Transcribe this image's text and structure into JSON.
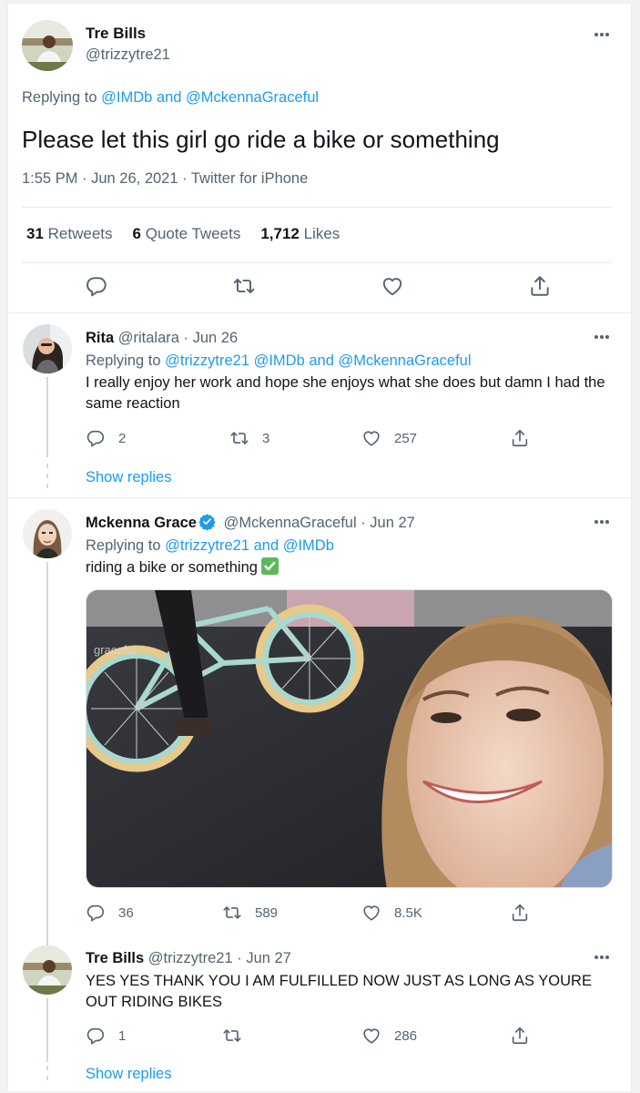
{
  "main_tweet": {
    "name": "Tre Bills",
    "handle": "@trizzytre21",
    "replying_prefix": "Replying to",
    "replying_to": "@IMDb and @MckennaGraceful",
    "text": "Please let this girl go ride a bike or something",
    "timestamp": "1:55 PM · Jun 26, 2021 · Twitter for iPhone",
    "stats": {
      "retweets_count": "31",
      "retweets_label": "Retweets",
      "quotes_count": "6",
      "quotes_label": "Quote Tweets",
      "likes_count": "1,712",
      "likes_label": "Likes"
    }
  },
  "replies": [
    {
      "name": "Rita",
      "handle_date": "@ritalara · Jun 26",
      "replying_prefix": "Replying to",
      "replying_to": "@trizzytre21 @IMDb and @MckennaGraceful",
      "text": "I really enjoy her work and hope she enjoys what she does but damn I had the same reaction",
      "replies_count": "2",
      "retweets_count": "3",
      "likes_count": "257",
      "show_replies": "Show replies"
    },
    {
      "name": "Mckenna Grace",
      "handle_date": "@MckennaGraceful · Jun 27",
      "replying_prefix": "Replying to",
      "replying_to": "@trizzytre21 and @IMDb",
      "text": "riding a bike or something",
      "media_watermark": "graceful",
      "replies_count": "36",
      "retweets_count": "589",
      "likes_count": "8.5K"
    },
    {
      "name": "Tre Bills",
      "handle_date": "@trizzytre21 · Jun 27",
      "text": "YES YES THANK YOU I AM FULFILLED NOW JUST AS LONG AS YOURE OUT RIDING BIKES",
      "replies_count": "1",
      "likes_count": "286",
      "show_replies": "Show replies"
    }
  ],
  "colors": {
    "accent_blue": "#1d9bf0",
    "text_primary": "#0f1419",
    "text_muted": "#536471",
    "border": "#e6ecf0"
  },
  "icons": [
    "reply-icon",
    "retweet-icon",
    "like-icon",
    "share-icon",
    "more-icon",
    "verified-badge-icon",
    "check-mark-emoji"
  ]
}
